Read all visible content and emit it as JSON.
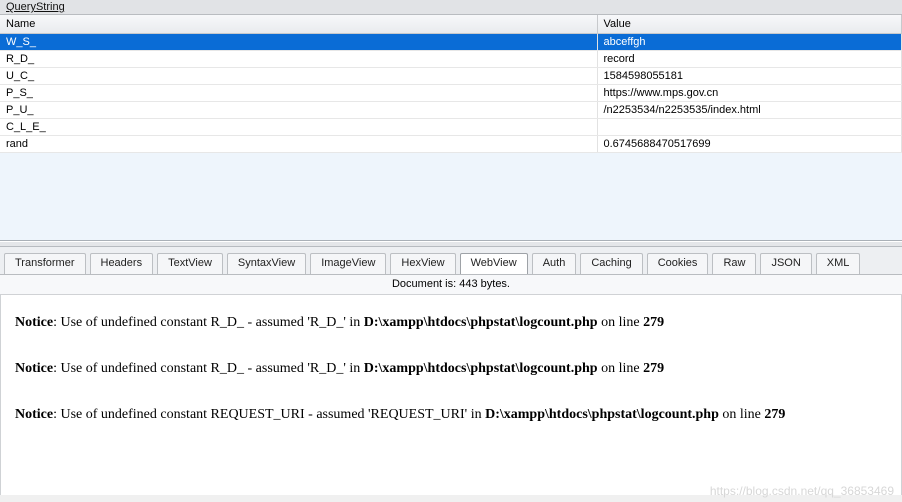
{
  "panel_label": "QueryString",
  "grid": {
    "columns": [
      "Name",
      "Value"
    ],
    "rows": [
      {
        "name": "W_S_",
        "value": "abceffgh",
        "selected": true
      },
      {
        "name": "R_D_",
        "value": "record"
      },
      {
        "name": "U_C_",
        "value": "1584598055181"
      },
      {
        "name": "P_S_",
        "value": "https://www.mps.gov.cn"
      },
      {
        "name": "P_U_",
        "value": "/n2253534/n2253535/index.html"
      },
      {
        "name": "C_L_E_",
        "value": ""
      },
      {
        "name": "rand",
        "value": "0.6745688470517699"
      }
    ]
  },
  "tabs": [
    "Transformer",
    "Headers",
    "TextView",
    "SyntaxView",
    "ImageView",
    "HexView",
    "WebView",
    "Auth",
    "Caching",
    "Cookies",
    "Raw",
    "JSON",
    "XML"
  ],
  "active_tab": "WebView",
  "doc_size": "Document is: 443 bytes.",
  "notices": [
    {
      "prefix": "Notice",
      "text": ": Use of undefined constant R_D_ - assumed 'R_D_' in ",
      "path": "D:\\xampp\\htdocs\\phpstat\\logcount.php",
      "mid": " on line ",
      "line": "279"
    },
    {
      "prefix": "Notice",
      "text": ": Use of undefined constant R_D_ - assumed 'R_D_' in ",
      "path": "D:\\xampp\\htdocs\\phpstat\\logcount.php",
      "mid": " on line ",
      "line": "279"
    },
    {
      "prefix": "Notice",
      "text": ": Use of undefined constant REQUEST_URI - assumed 'REQUEST_URI' in ",
      "path": "D:\\xampp\\htdocs\\phpstat\\logcount.php",
      "mid": " on line ",
      "line": "279"
    }
  ],
  "watermark": "https://blog.csdn.net/qq_36853469"
}
